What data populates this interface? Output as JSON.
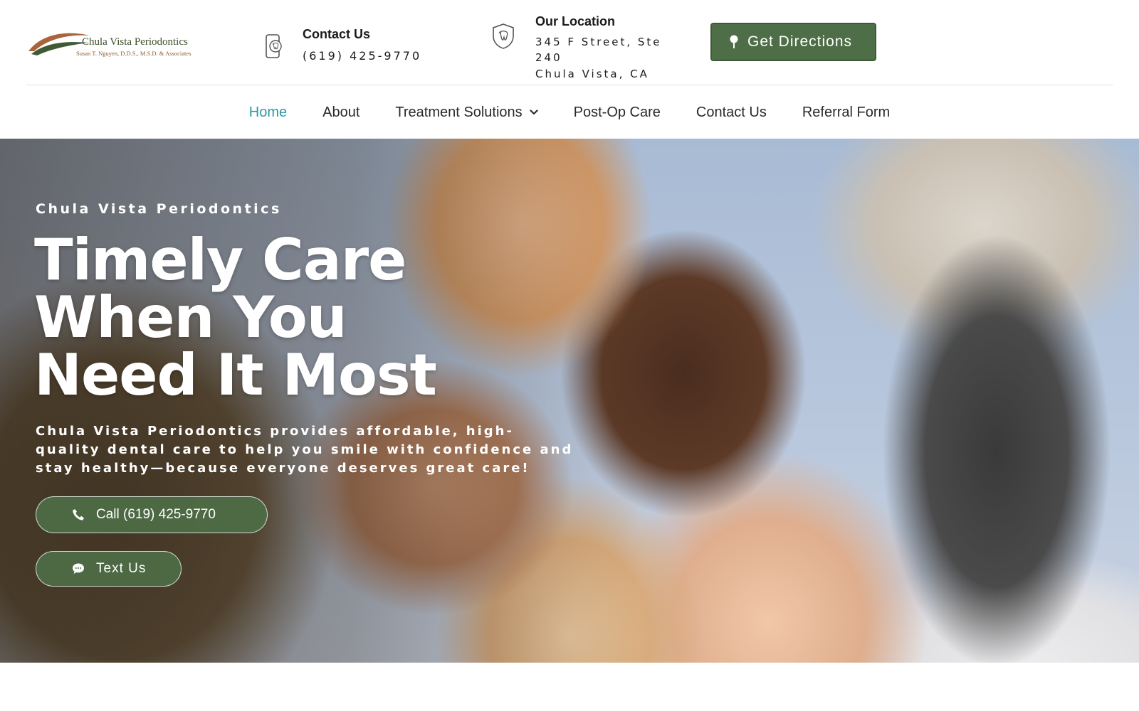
{
  "header": {
    "logo": {
      "name": "Chula Vista Periodontics",
      "subtitle": "Susan T. Nguyen, D.D.S., M.S.D. & Associates"
    },
    "contact": {
      "title": "Contact Us",
      "phone": "(619) 425-9770",
      "icon": "phone-tooth-icon"
    },
    "location": {
      "title": "Our Location",
      "lines": [
        "345 F Street, Ste",
        "240",
        "Chula Vista, CA"
      ],
      "icon": "shield-tooth-icon"
    },
    "directions_label": "Get Directions"
  },
  "nav": {
    "items": [
      {
        "label": "Home",
        "active": true
      },
      {
        "label": "About"
      },
      {
        "label": "Treatment Solutions",
        "has_dropdown": true
      },
      {
        "label": "Post-Op Care"
      },
      {
        "label": "Contact Us"
      },
      {
        "label": "Referral Form"
      }
    ]
  },
  "hero": {
    "kicker": "Chula Vista Periodontics",
    "title_lines": [
      "Timely Care",
      "When You",
      "Need It Most"
    ],
    "description": "Chula Vista Periodontics provides affordable, high-quality dental care to help you smile with confidence and stay healthy—because everyone deserves great care!",
    "call_label": "Call (619) 425-9770",
    "text_label": "Text Us"
  },
  "colors": {
    "brand_green": "#4e6e47",
    "nav_active": "#2a99a6",
    "text_dark": "#1b1b1b"
  }
}
